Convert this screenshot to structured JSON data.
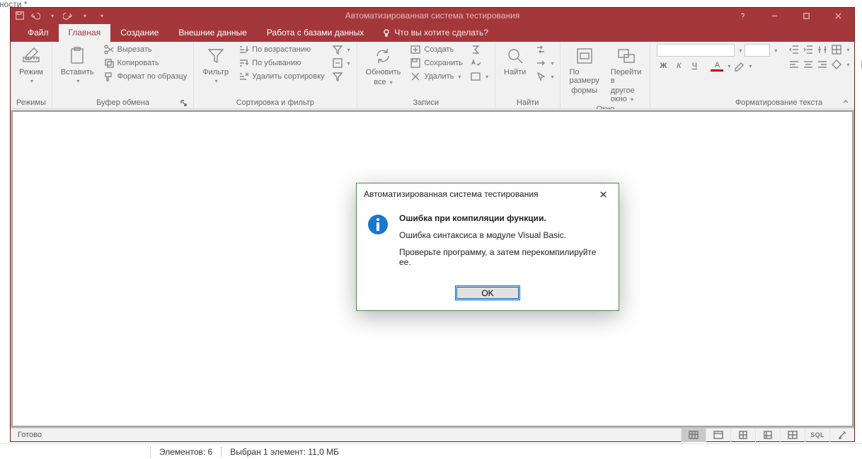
{
  "bg_text": "ности *",
  "titlebar": {
    "title": "Автоматизированная система тестирования"
  },
  "tabs": {
    "file": "Файл",
    "home": "Главная",
    "create": "Создание",
    "external": "Внешние данные",
    "dbtools": "Работа с базами данных",
    "tellme": "Что вы хотите сделать?"
  },
  "ribbon": {
    "views": {
      "mode": "Режим",
      "label": "Режимы"
    },
    "clipboard": {
      "paste": "Вставить",
      "cut": "Вырезать",
      "copy": "Копировать",
      "format": "Формат по образцу",
      "label": "Буфер обмена"
    },
    "sort": {
      "filter": "Фильтр",
      "asc": "По возрастанию",
      "desc": "По убыванию",
      "clear": "Удалить сортировку",
      "label": "Сортировка и фильтр"
    },
    "records": {
      "refresh": "Обновить",
      "refresh2": "все",
      "new": "Создать",
      "save": "Сохранить",
      "delete": "Удалить",
      "label": "Записи"
    },
    "find": {
      "find": "Найти",
      "label": "Найти"
    },
    "window": {
      "size": "По размеру",
      "size2": "формы",
      "switch": "Перейти в",
      "switch2": "другое окно",
      "label": "Окно"
    },
    "format": {
      "label": "Форматирование текста",
      "b": "Ж",
      "i": "К",
      "u": "Ч",
      "a": "A"
    }
  },
  "dialog": {
    "title": "Автоматизированная система тестирования",
    "heading": "Ошибка при компиляции функции.",
    "line1": "Ошибка синтаксиса в модуле Visual Basic.",
    "line2": "Проверьте программу, а затем перекомпилируйте ее.",
    "ok": "OK"
  },
  "status": {
    "ready": "Готово",
    "sql": "SQL"
  },
  "taskbar": {
    "count": "Элементов: 6",
    "selected": "Выбран 1 элемент: 11,0 МБ"
  }
}
